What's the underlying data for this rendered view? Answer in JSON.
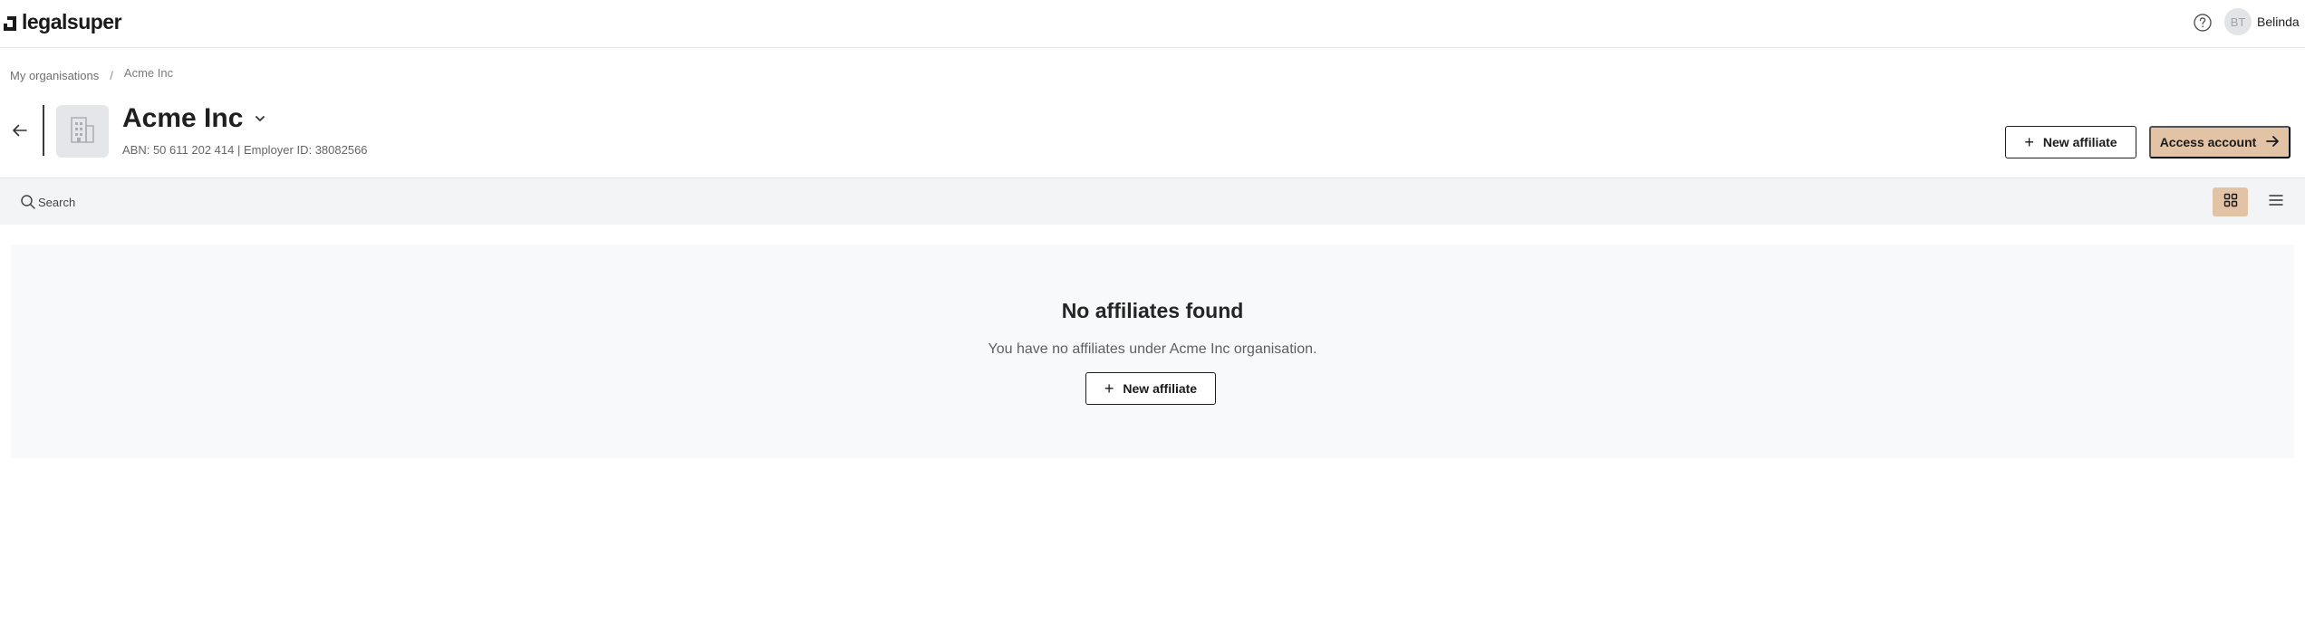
{
  "app": {
    "logo_text": "legalsuper"
  },
  "user": {
    "initials": "BT",
    "name": "Belinda"
  },
  "breadcrumb": {
    "items": [
      "My organisations",
      "Acme Inc"
    ],
    "separator": "/"
  },
  "organisation": {
    "name": "Acme Inc",
    "meta": "ABN: 50 611 202 414 | Employer ID: 38082566"
  },
  "actions": {
    "new_affiliate_label": "New affiliate",
    "access_account_label": "Access account"
  },
  "search": {
    "placeholder": "Search",
    "value": ""
  },
  "view_toggle": {
    "selected": "grid",
    "options": [
      "grid-icon",
      "list-icon"
    ]
  },
  "empty_state": {
    "title": "No affiliates found",
    "message": "You have no affiliates under Acme Inc organisation.",
    "button_label": "New affiliate"
  },
  "colors": {
    "accent": "#e2c3a6",
    "search_bg": "#f3f4f6",
    "empty_bg": "#f8f9fa"
  }
}
